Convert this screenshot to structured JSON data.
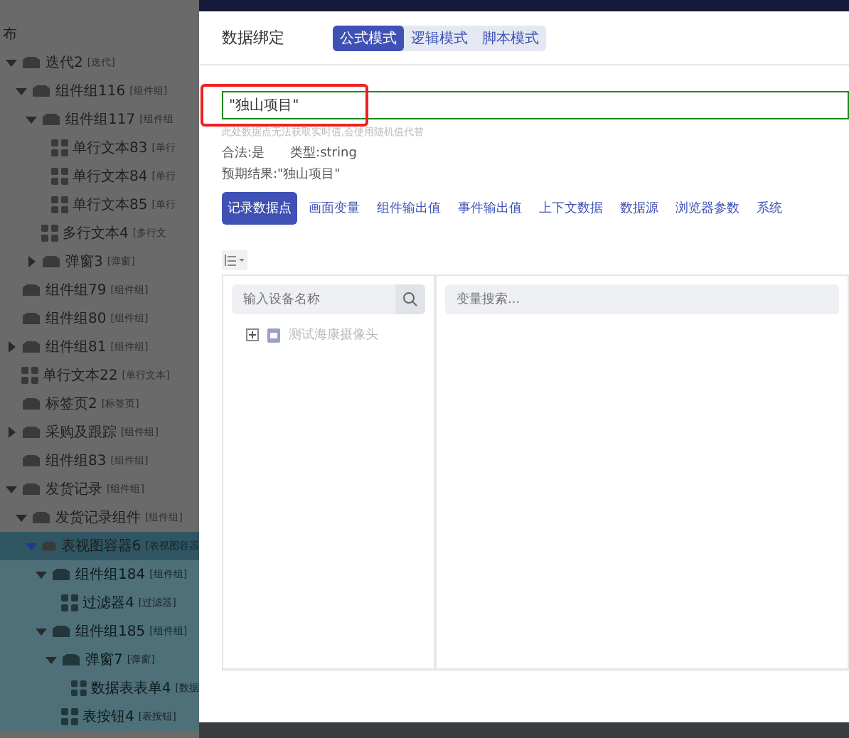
{
  "tree": [
    {
      "label": "布",
      "kind": "none",
      "selected": false
    },
    {
      "label": "迭代2",
      "tag": "[迭代]",
      "kind": "group",
      "expanded": true,
      "selected": false,
      "children": [
        {
          "label": "组件组116",
          "tag": "[组件组]",
          "kind": "group",
          "expanded": true,
          "selected": false,
          "children": [
            {
              "label": "组件组117",
              "tag": "[组件组",
              "kind": "group",
              "expanded": true,
              "selected": false,
              "children": [
                {
                  "label": "单行文本83",
                  "tag": "[单行",
                  "kind": "widget",
                  "selected": false
                },
                {
                  "label": "单行文本84",
                  "tag": "[单行",
                  "kind": "widget",
                  "selected": false
                },
                {
                  "label": "单行文本85",
                  "tag": "[单行",
                  "kind": "widget",
                  "selected": false
                }
              ]
            },
            {
              "label": "多行文本4",
              "tag": "[多行文",
              "kind": "widget",
              "selected": false
            },
            {
              "label": "弹窗3",
              "tag": "[弹窗]",
              "kind": "group",
              "expanded": false,
              "selected": false
            }
          ]
        }
      ]
    },
    {
      "label": "组件组79",
      "tag": "[组件组]",
      "kind": "group",
      "selected": false
    },
    {
      "label": "组件组80",
      "tag": "[组件组]",
      "kind": "group",
      "selected": false
    },
    {
      "label": "组件组81",
      "tag": "[组件组]",
      "kind": "group",
      "expanded": false,
      "selected": false
    },
    {
      "label": "单行文本22",
      "tag": "[单行文本]",
      "kind": "widget",
      "selected": false
    },
    {
      "label": "标签页2",
      "tag": "[标签页]",
      "kind": "group",
      "selected": false
    },
    {
      "label": "采购及跟踪",
      "tag": "[组件组]",
      "kind": "group",
      "expanded": false,
      "selected": false
    },
    {
      "label": "组件组83",
      "tag": "[组件组]",
      "kind": "group",
      "selected": false
    },
    {
      "label": "发货记录",
      "tag": "[组件组]",
      "kind": "group",
      "expanded": true,
      "selected": false,
      "children": [
        {
          "label": "发货记录组件",
          "tag": "[组件组]",
          "kind": "group",
          "expanded": true,
          "selected": false,
          "children": [
            {
              "label": "表视图容器6",
              "tag": "[表视图容器",
              "kind": "group",
              "expanded": true,
              "selected": true,
              "children": [
                {
                  "label": "组件组184",
                  "tag": "[组件组]",
                  "kind": "group",
                  "expanded": true,
                  "selected": false,
                  "children": [
                    {
                      "label": "过滤器4",
                      "tag": "[过滤器]",
                      "kind": "widget",
                      "selected": false
                    }
                  ]
                },
                {
                  "label": "组件组185",
                  "tag": "[组件组]",
                  "kind": "group",
                  "expanded": true,
                  "selected": false,
                  "children": [
                    {
                      "label": "弹窗7",
                      "tag": "[弹窗]",
                      "kind": "group",
                      "expanded": true,
                      "selected": false,
                      "children": [
                        {
                          "label": "数据表表单4",
                          "tag": "[数据",
                          "kind": "widget",
                          "selected": false
                        }
                      ]
                    },
                    {
                      "label": "表按钮4",
                      "tag": "[表按钮]",
                      "kind": "widget",
                      "selected": false
                    }
                  ]
                }
              ]
            }
          ]
        }
      ]
    }
  ],
  "dialog": {
    "title": "数据绑定",
    "modes": [
      {
        "label": "公式模式",
        "selected": true
      },
      {
        "label": "逻辑模式",
        "selected": false
      },
      {
        "label": "脚本模式",
        "selected": false
      }
    ],
    "formula": {
      "value": "\"独山项目\"",
      "valid": true,
      "highlighted": true
    },
    "hint": "此处数据点无法获取实时值,会使用随机值代替",
    "validity": "合法:是",
    "type": "类型:string",
    "expected": "预期结果:\"独山项目\"",
    "sources": [
      {
        "label": "记录数据点",
        "selected": true
      },
      {
        "label": "画面变量",
        "selected": false
      },
      {
        "label": "组件输出值",
        "selected": false
      },
      {
        "label": "事件输出值",
        "selected": false
      },
      {
        "label": "上下文数据",
        "selected": false
      },
      {
        "label": "数据源",
        "selected": false
      },
      {
        "label": "浏览器参数",
        "selected": false
      },
      {
        "label": "系统",
        "selected": false
      }
    ],
    "device_search": {
      "placeholder": "输入设备名称"
    },
    "devices": [
      {
        "label": "测试海康摄像头",
        "expanded": false
      }
    ],
    "variable_search": {
      "placeholder": "变量搜索..."
    }
  }
}
